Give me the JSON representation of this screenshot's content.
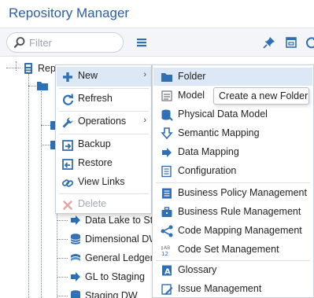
{
  "app": {
    "title": "Repository Manager"
  },
  "toolbar": {
    "filter_placeholder": "Filter",
    "icons": [
      "search-icon",
      "hamburger-menu-icon",
      "pin-icon",
      "window-icon",
      "refresh-arrow-icon"
    ]
  },
  "tree": {
    "root_label": "Repo",
    "children": [
      {
        "label": "Data Lake to St",
        "icon": "data-mapping-icon"
      },
      {
        "label": "Dimensional DW",
        "icon": "database-icon"
      },
      {
        "label": "General Ledger",
        "icon": "semantic-icon"
      },
      {
        "label": "GL to Staging",
        "icon": "data-mapping-icon"
      },
      {
        "label": "Staging DW",
        "icon": "database-icon"
      }
    ]
  },
  "context_menu": {
    "items": [
      {
        "label": "New",
        "icon": "plus-icon",
        "arrow": "›"
      },
      {
        "label": "Refresh",
        "icon": "refresh-icon"
      },
      {
        "label": "Operations",
        "icon": "wrench-icon",
        "arrow": "›"
      },
      {
        "label": "Backup",
        "icon": "backup-icon"
      },
      {
        "label": "Restore",
        "icon": "restore-icon"
      },
      {
        "label": "View Links",
        "icon": "link-icon"
      },
      {
        "label": "Delete",
        "icon": "delete-icon",
        "disabled": true
      }
    ]
  },
  "submenu": {
    "items": [
      {
        "label": "Folder",
        "icon": "folder-icon"
      },
      {
        "label": "Model",
        "icon": "model-icon"
      },
      {
        "label": "Physical Data Model",
        "icon": "physical-data-model-icon"
      },
      {
        "label": "Semantic Mapping",
        "icon": "semantic-mapping-icon"
      },
      {
        "label": "Data Mapping",
        "icon": "data-mapping-icon"
      },
      {
        "label": "Configuration",
        "icon": "configuration-icon"
      },
      {
        "label": "Business Policy Management",
        "icon": "business-policy-icon"
      },
      {
        "label": "Business Rule Management",
        "icon": "business-rule-icon"
      },
      {
        "label": "Code Mapping Management",
        "icon": "code-mapping-icon"
      },
      {
        "label": "Code Set Management",
        "icon": "code-set-icon"
      },
      {
        "label": "Glossary",
        "icon": "glossary-icon"
      },
      {
        "label": "Issue Management",
        "icon": "issue-icon"
      }
    ]
  },
  "tooltip": {
    "text": "Create a new Folder"
  },
  "colors": {
    "title": "#2e5e9e",
    "icon_blue": "#2f6fb3",
    "active_bg": "#dde8f6",
    "disabled": "#a3a9b0"
  }
}
